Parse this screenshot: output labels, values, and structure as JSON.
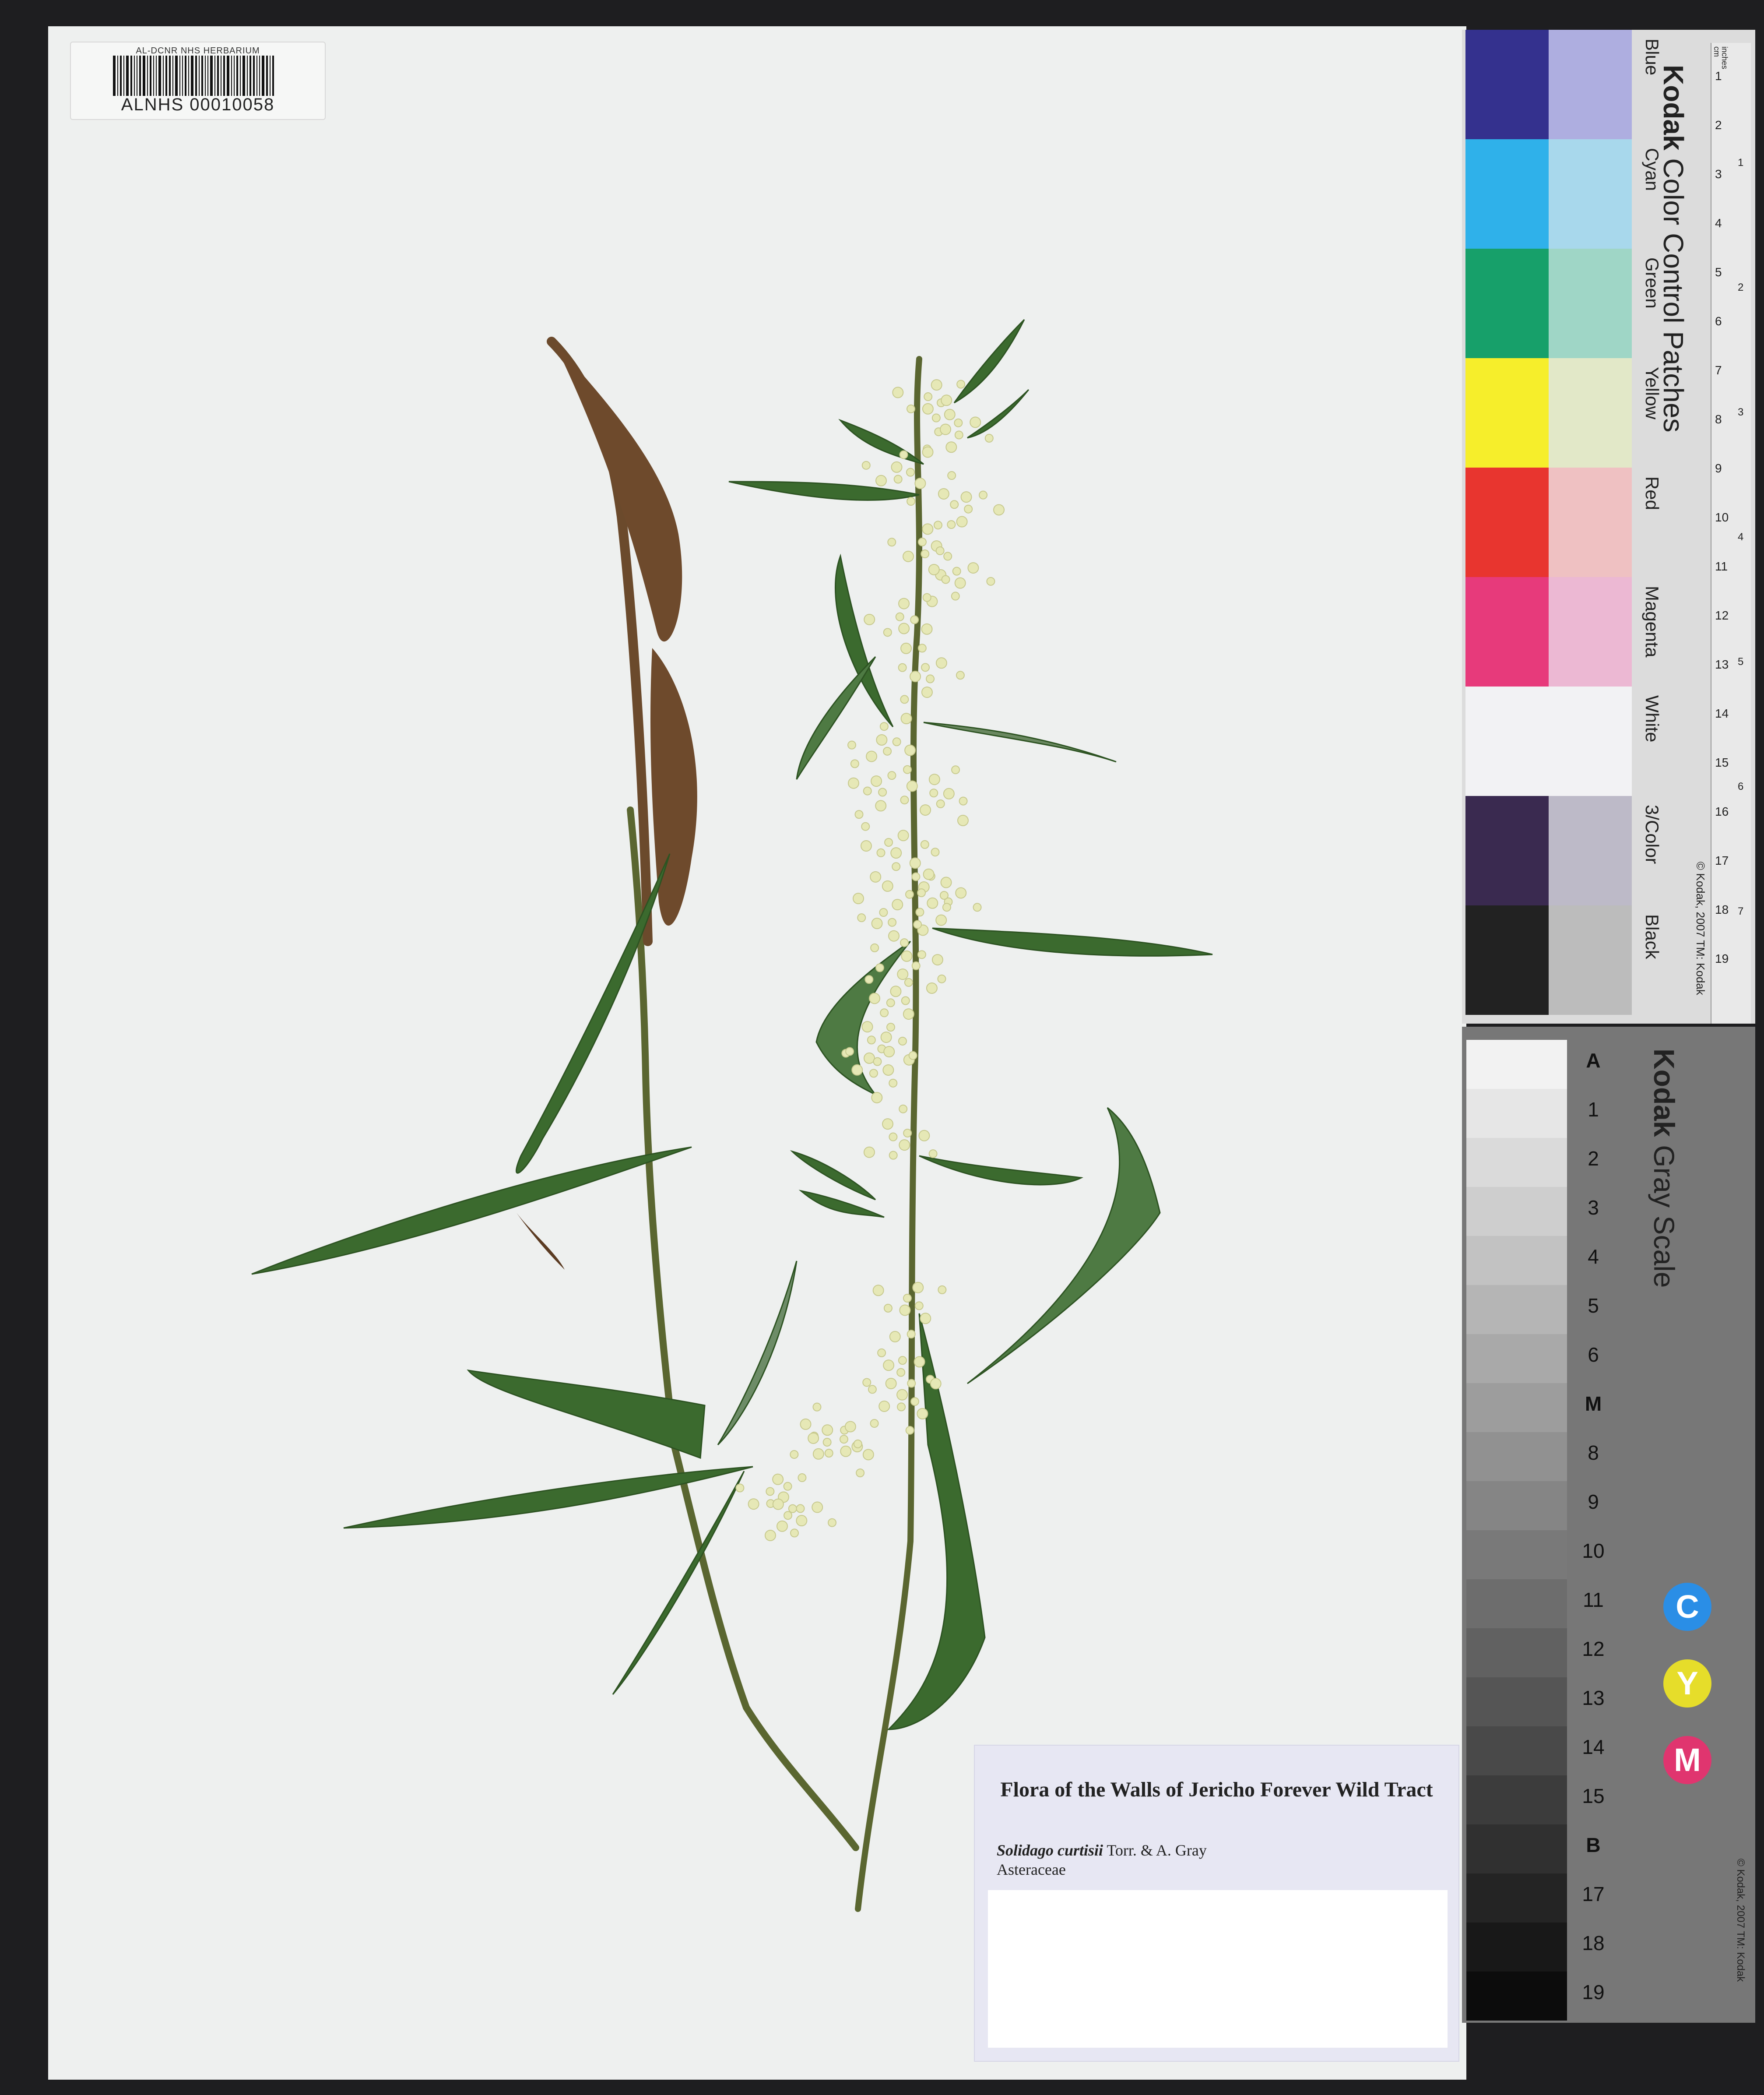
{
  "specimen": {
    "barcode_header": "AL-DCNR NHS HERBARIUM",
    "catalog_number": "ALNHS 00010058"
  },
  "label": {
    "title": "Flora of the Walls of Jericho Forever Wild Tract",
    "species": "Solidago curtisii",
    "authority": "Torr. & A. Gray",
    "family": "Asteraceae"
  },
  "color_card": {
    "brand": "Kodak",
    "title": "Color Control Patches",
    "copyright": "© Kodak, 2007 TM: Kodak",
    "units": [
      "inches",
      "cm"
    ],
    "patches": [
      {
        "name": "Blue",
        "dark": "#34318e",
        "light": "#aeaee0"
      },
      {
        "name": "Cyan",
        "dark": "#2fb1ea",
        "light": "#a8d8ec"
      },
      {
        "name": "Green",
        "dark": "#17a06a",
        "light": "#9fd6c6"
      },
      {
        "name": "Yellow",
        "dark": "#f6ee2b",
        "light": "#e2e8c8"
      },
      {
        "name": "Red",
        "dark": "#e8352f",
        "light": "#efc1c2"
      },
      {
        "name": "Magenta",
        "dark": "#e73a7b",
        "light": "#ecb8d3"
      },
      {
        "name": "White",
        "dark": "#f2f2f4",
        "light": "#f2f2f4"
      },
      {
        "name": "3/Color",
        "dark": "#3a2a50",
        "light": "#bdbac8"
      },
      {
        "name": "Black",
        "dark": "#222222",
        "light": "#bcbcbc"
      }
    ],
    "cm_ticks": [
      "1",
      "2",
      "3",
      "4",
      "5",
      "6",
      "7",
      "8",
      "9",
      "10",
      "11",
      "12",
      "13",
      "14",
      "15",
      "16",
      "17",
      "18",
      "19"
    ],
    "inch_ticks": [
      "1",
      "2",
      "3",
      "4",
      "5",
      "6",
      "7"
    ]
  },
  "gray_scale": {
    "brand": "Kodak",
    "title": "Gray Scale",
    "copyright": "© Kodak, 2007 TM: Kodak",
    "steps": [
      "A",
      "1",
      "2",
      "3",
      "4",
      "5",
      "6",
      "M",
      "8",
      "9",
      "10",
      "11",
      "12",
      "13",
      "14",
      "15",
      "B",
      "17",
      "18",
      "19"
    ],
    "cym": [
      {
        "letter": "C",
        "color": "#2a8ee6"
      },
      {
        "letter": "Y",
        "color": "#e6dd2a"
      },
      {
        "letter": "M",
        "color": "#e0356f"
      }
    ]
  },
  "colors": {
    "sheet": "#eef0ef",
    "leaf": "#3b6a2e",
    "stem": "#5d6b35",
    "flower": "#e6e8b6",
    "background": "#1e1e20"
  }
}
